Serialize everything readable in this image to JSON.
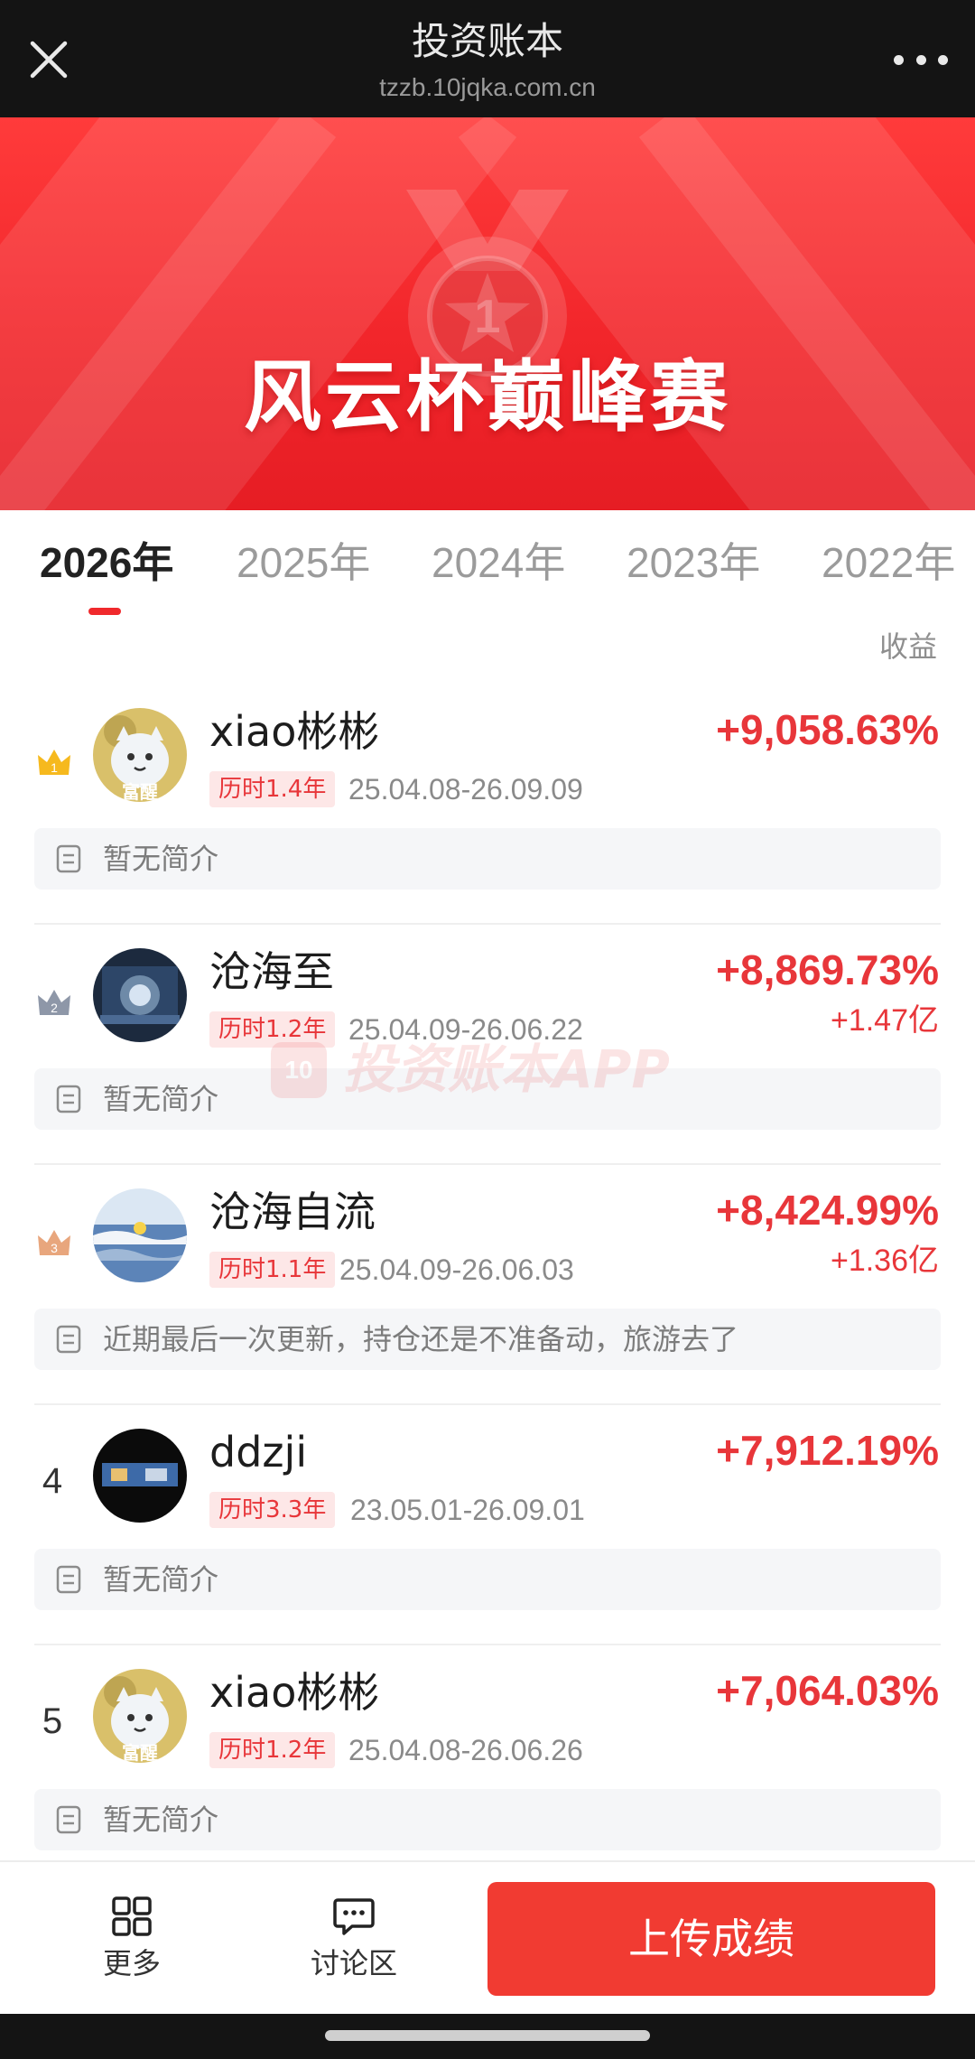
{
  "browser": {
    "title": "投资账本",
    "url": "tzzb.10jqka.com.cn",
    "icons": {
      "close": "close-icon",
      "more": "more-dots-icon"
    }
  },
  "banner": {
    "title": "风云杯巅峰赛",
    "medal_number": "1",
    "colors": {
      "start": "#ff3b3b",
      "end": "#e61d24"
    }
  },
  "tabs": [
    {
      "label": "2026年",
      "active": true
    },
    {
      "label": "2025年",
      "active": false
    },
    {
      "label": "2024年",
      "active": false
    },
    {
      "label": "2023年",
      "active": false
    },
    {
      "label": "2022年",
      "active": false
    }
  ],
  "column_header": "收益",
  "entries": [
    {
      "rank": "1",
      "rank_style": "crown-gold",
      "name": "xiao彬彬",
      "duration": "历时1.4年",
      "dates": "25.04.08-26.09.09",
      "return_pct": "+9,058.63%",
      "amount": "",
      "intro": "暂无简介",
      "avatar": "cartoon-avatar",
      "avatar_text": "富醒"
    },
    {
      "rank": "2",
      "rank_style": "crown-silver",
      "name": "沧海至",
      "duration": "历时1.2年",
      "dates": "25.04.09-26.06.22",
      "return_pct": "+8,869.73%",
      "amount": "+1.47亿",
      "intro": "暂无简介",
      "avatar": "tech-avatar",
      "avatar_text": ""
    },
    {
      "rank": "3",
      "rank_style": "crown-bronze",
      "name": "沧海自流",
      "duration": "历时1.1年",
      "dates": "25.04.09-26.06.03",
      "return_pct": "+8,424.99%",
      "amount": "+1.36亿",
      "intro": "近期最后一次更新，持仓还是不准备动，旅游去了",
      "avatar": "sea-avatar",
      "avatar_text": ""
    },
    {
      "rank": "4",
      "rank_style": "number",
      "name": "ddzji",
      "duration": "历时3.3年",
      "dates": "23.05.01-26.09.01",
      "return_pct": "+7,912.19%",
      "amount": "",
      "intro": "暂无简介",
      "avatar": "dark-avatar",
      "avatar_text": ""
    },
    {
      "rank": "5",
      "rank_style": "number",
      "name": "xiao彬彬",
      "duration": "历时1.2年",
      "dates": "25.04.08-26.06.26",
      "return_pct": "+7,064.03%",
      "amount": "",
      "intro": "暂无简介",
      "avatar": "cartoon-avatar",
      "avatar_text": "富醒"
    }
  ],
  "watermark": {
    "logo": "10",
    "text": "投资账本APP"
  },
  "bottom_bar": {
    "more_label": "更多",
    "discuss_label": "讨论区",
    "upload_label": "上传成绩"
  },
  "accent_color": "#e8363a"
}
